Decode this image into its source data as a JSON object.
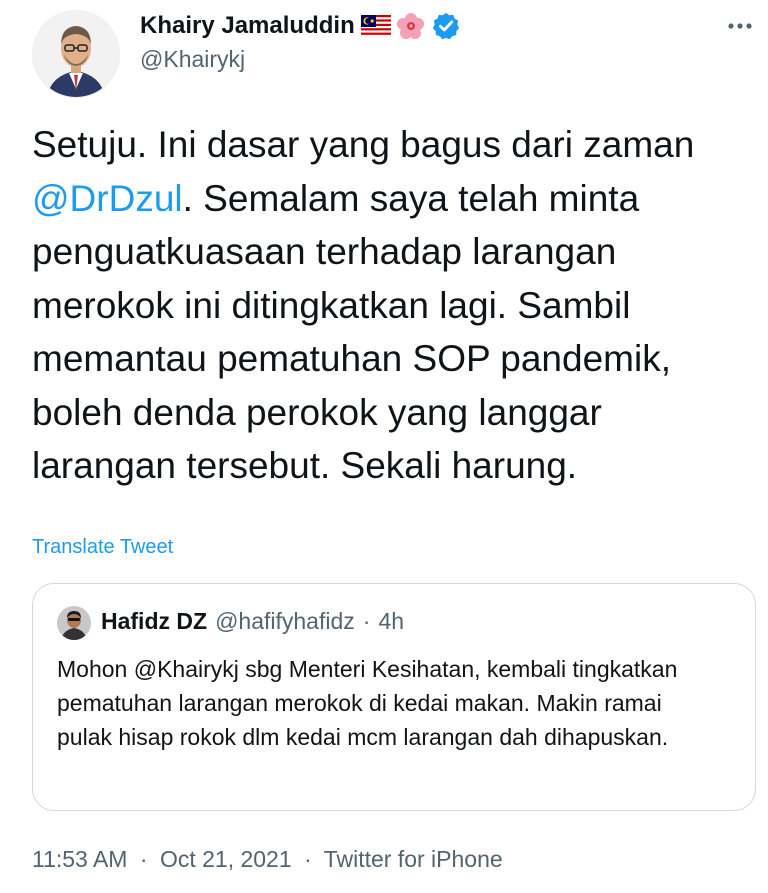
{
  "author": {
    "name": "Khairy Jamaluddin",
    "handle": "@Khairykj",
    "verified": true,
    "name_emojis": [
      "malaysia-flag",
      "hibiscus"
    ]
  },
  "tweet": {
    "text_1": "Setuju. Ini dasar yang bagus dari zaman ",
    "mention": "@DrDzul",
    "text_2": ". Semalam saya telah minta penguatkuasaan terhadap larangan merokok ini ditingkatkan lagi. Sambil memantau pematuhan SOP pandemik, boleh denda perokok yang langgar larangan tersebut. Sekali harung.",
    "translate_label": "Translate Tweet"
  },
  "quoted_tweet": {
    "name": "Hafidz DZ",
    "handle": "@hafifyhafidz",
    "separator": "·",
    "time": "4h",
    "text": "Mohon @Khairykj sbg Menteri Kesihatan, kembali tingkatkan pematuhan larangan merokok di kedai makan. Makin ramai pulak hisap rokok dlm kedai mcm larangan dah dihapuskan."
  },
  "footer": {
    "time": "11:53 AM",
    "separator": "·",
    "date": "Oct 21, 2021",
    "source": "Twitter for iPhone"
  },
  "colors": {
    "accent": "#1d9bf0",
    "text": "#0f1419",
    "secondary": "#536471",
    "border": "#cfd9de"
  }
}
